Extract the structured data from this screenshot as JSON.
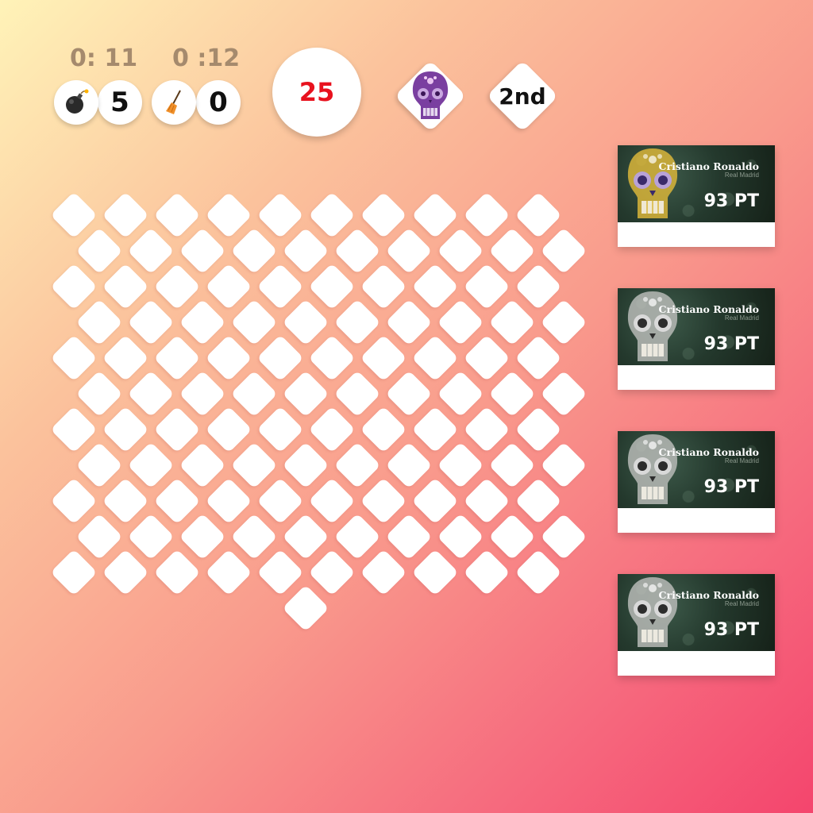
{
  "timers": {
    "left": "0: 11",
    "right": "0 :12"
  },
  "counters": {
    "bomb_count": "5",
    "broom_count": "0"
  },
  "score": "25",
  "rank": "2nd",
  "icons": {
    "bomb": "bomb-icon",
    "broom": "broom-icon",
    "skull_badge": "sugar-skull-icon"
  },
  "board": {
    "rows": [
      10,
      10,
      10,
      10,
      10,
      10,
      10,
      10,
      10,
      10,
      10,
      1
    ]
  },
  "players": [
    {
      "name": "Cristiano Ronaldo",
      "club": "Real Madrid",
      "points": "93 PT",
      "skull_color": "gold"
    },
    {
      "name": "Cristiano Ronaldo",
      "club": "Real Madrid",
      "points": "93 PT",
      "skull_color": "grey"
    },
    {
      "name": "Cristiano Ronaldo",
      "club": "Real Madrid",
      "points": "93 PT",
      "skull_color": "grey"
    },
    {
      "name": "Cristiano Ronaldo",
      "club": "Real Madrid",
      "points": "93 PT",
      "skull_color": "grey"
    }
  ],
  "colors": {
    "score": "#e8121e",
    "timer": "#a58a6d",
    "skull_gold": "#d9b53a",
    "skull_grey": "#b7bab6"
  }
}
